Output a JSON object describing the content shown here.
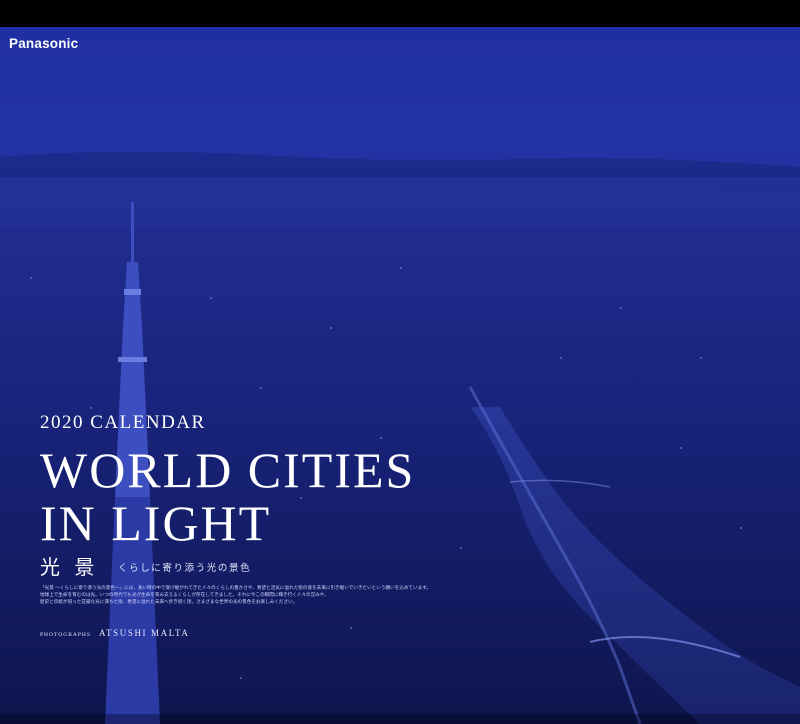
{
  "brand": "Panasonic",
  "calendar_label": "2020 CALENDAR",
  "title_line_1": "WORLD CITIES",
  "title_line_2": "IN LIGHT",
  "jp_title": "光 景",
  "jp_subtitle": "くらしに寄り添う光の景色",
  "description": [
    "「光景 ～くらしに寄り添う光の景色～」には、長い時の中で受け継がれてきた人々のくらしの豊かさや、希望と活気に溢れた街の姿を未来に引き継いでいきたいという願いを込めています。",
    "地球上で生命を育むのは光。いつの時代でも光が生命を育み支えるくらしが存在してきました。それに今この瞬間に輝き行く人々の営みや、",
    "歴史と伝統が培った荘厳な光に満ちた街、希望に溢れた未来へ歩き続く街。さまざまな世界の光の景色をお楽しみください。"
  ],
  "credit_label": "PHOTOGRAPHS",
  "photographer": "ATSUSHI MALTA"
}
